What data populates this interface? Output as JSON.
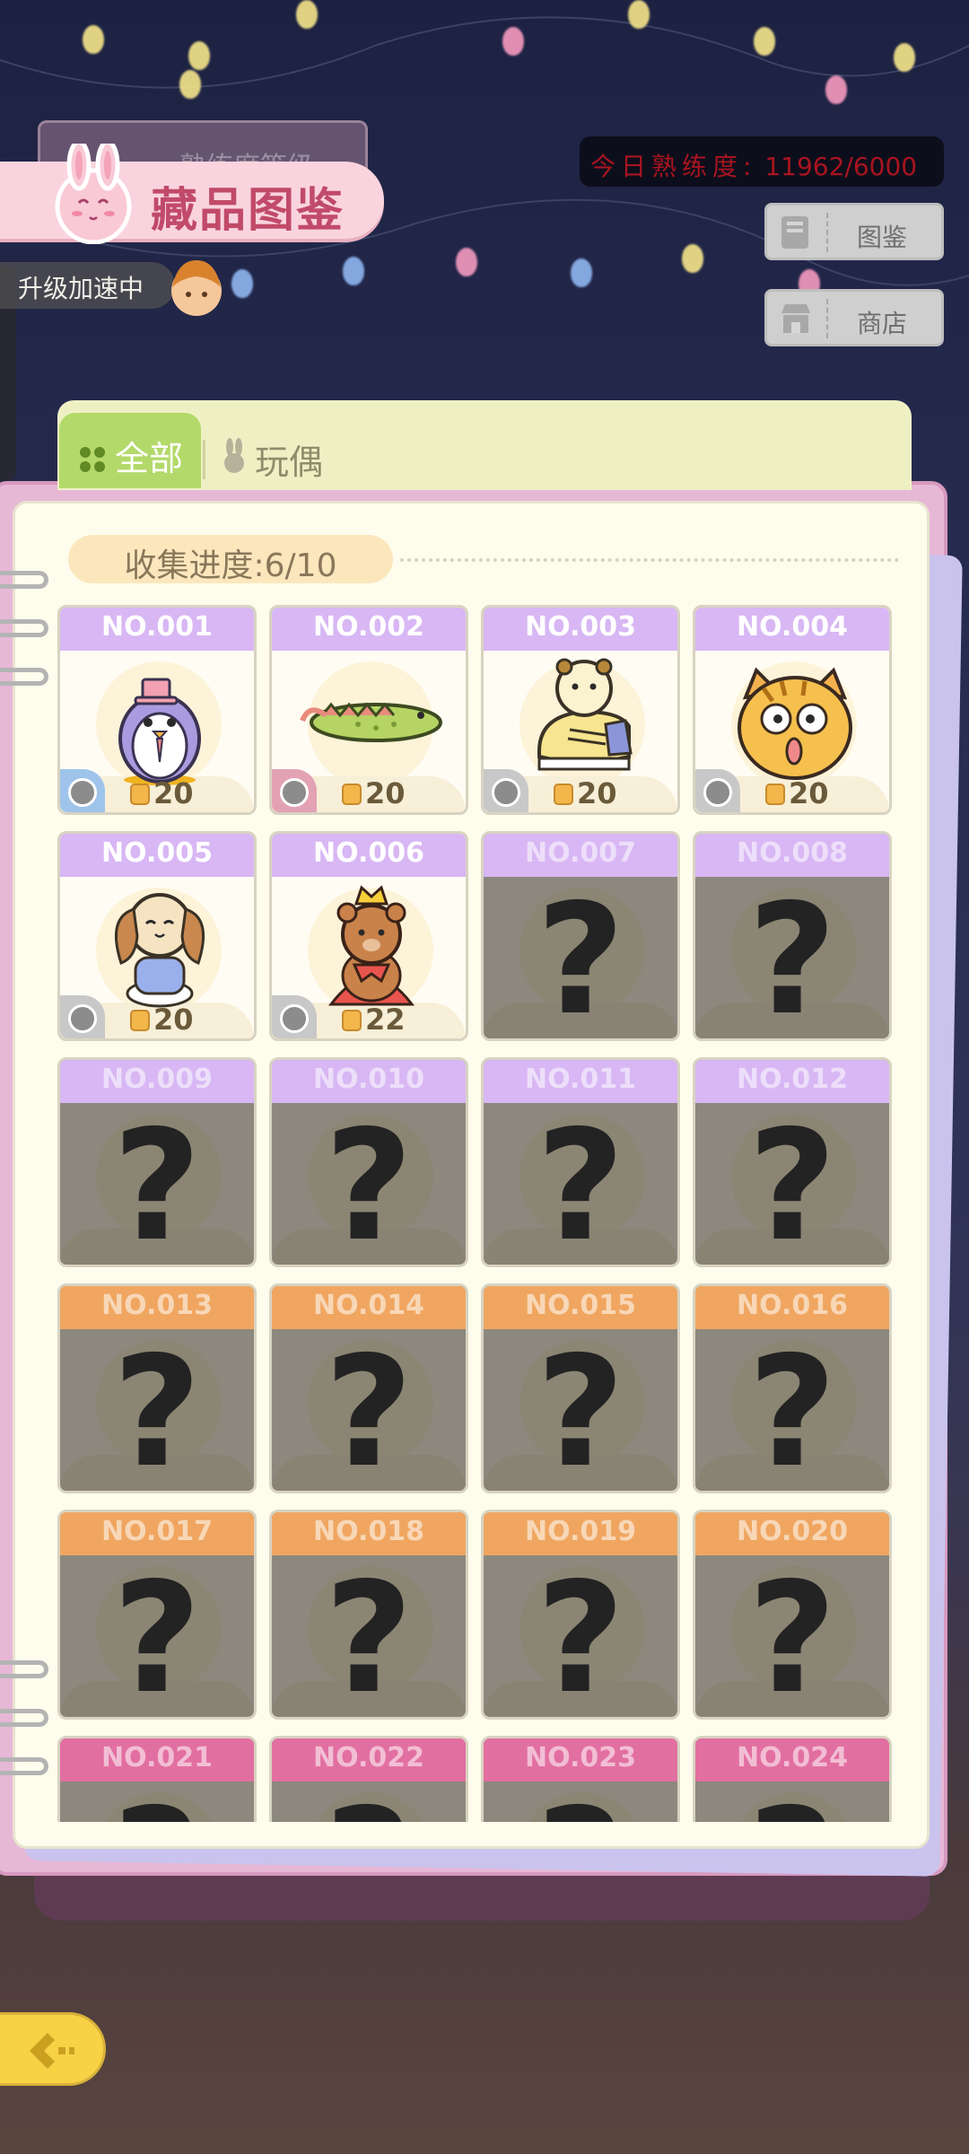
{
  "header": {
    "ghost_label": "熟练度等级",
    "title": "藏品图鉴",
    "boost_label": "升级加速中",
    "proficiency_label": "今日熟练度:",
    "proficiency_value": "11962/6000"
  },
  "side_buttons": [
    {
      "label": "图鉴",
      "icon": "book-icon"
    },
    {
      "label": "商店",
      "icon": "shop-icon"
    }
  ],
  "tabs": [
    {
      "label": "全部",
      "icon": "grid-icon",
      "active": true
    },
    {
      "label": "玩偶",
      "icon": "bunny-icon",
      "active": false
    }
  ],
  "progress_label": "收集进度:6/10",
  "cards": [
    {
      "no": "NO.001",
      "unlocked": true,
      "price": "20",
      "art": "penguin",
      "tag_color": "#9fc4ec",
      "hdr": "purple"
    },
    {
      "no": "NO.002",
      "unlocked": true,
      "price": "20",
      "art": "crocodile",
      "tag_color": "#e3a2b4",
      "hdr": "purple"
    },
    {
      "no": "NO.003",
      "unlocked": true,
      "price": "20",
      "art": "hamster-shoe",
      "tag_color": "#c8c8c8",
      "hdr": "purple"
    },
    {
      "no": "NO.004",
      "unlocked": true,
      "price": "20",
      "art": "cat",
      "tag_color": "#c8c8c8",
      "hdr": "purple"
    },
    {
      "no": "NO.005",
      "unlocked": true,
      "price": "20",
      "art": "puppy",
      "tag_color": "#c8c8c8",
      "hdr": "purple"
    },
    {
      "no": "NO.006",
      "unlocked": true,
      "price": "22",
      "art": "bear-king",
      "tag_color": "#c8c8c8",
      "hdr": "purple"
    },
    {
      "no": "NO.007",
      "unlocked": false,
      "hdr": "purple"
    },
    {
      "no": "NO.008",
      "unlocked": false,
      "hdr": "purple"
    },
    {
      "no": "NO.009",
      "unlocked": false,
      "hdr": "purple"
    },
    {
      "no": "NO.010",
      "unlocked": false,
      "hdr": "purple"
    },
    {
      "no": "NO.011",
      "unlocked": false,
      "hdr": "purple"
    },
    {
      "no": "NO.012",
      "unlocked": false,
      "hdr": "purple"
    },
    {
      "no": "NO.013",
      "unlocked": false,
      "hdr": "orange"
    },
    {
      "no": "NO.014",
      "unlocked": false,
      "hdr": "orange"
    },
    {
      "no": "NO.015",
      "unlocked": false,
      "hdr": "orange"
    },
    {
      "no": "NO.016",
      "unlocked": false,
      "hdr": "orange"
    },
    {
      "no": "NO.017",
      "unlocked": false,
      "hdr": "orange"
    },
    {
      "no": "NO.018",
      "unlocked": false,
      "hdr": "orange"
    },
    {
      "no": "NO.019",
      "unlocked": false,
      "hdr": "orange"
    },
    {
      "no": "NO.020",
      "unlocked": false,
      "hdr": "orange"
    },
    {
      "no": "NO.021",
      "unlocked": false,
      "hdr": "pink"
    },
    {
      "no": "NO.022",
      "unlocked": false,
      "hdr": "pink"
    },
    {
      "no": "NO.023",
      "unlocked": false,
      "hdr": "pink"
    },
    {
      "no": "NO.024",
      "unlocked": false,
      "hdr": "pink"
    }
  ],
  "colors": {
    "accent_pink": "#c14a6a",
    "tab_active": "#b3d96a",
    "proficiency_red": "#a81420",
    "back_button": "#f7d245"
  }
}
